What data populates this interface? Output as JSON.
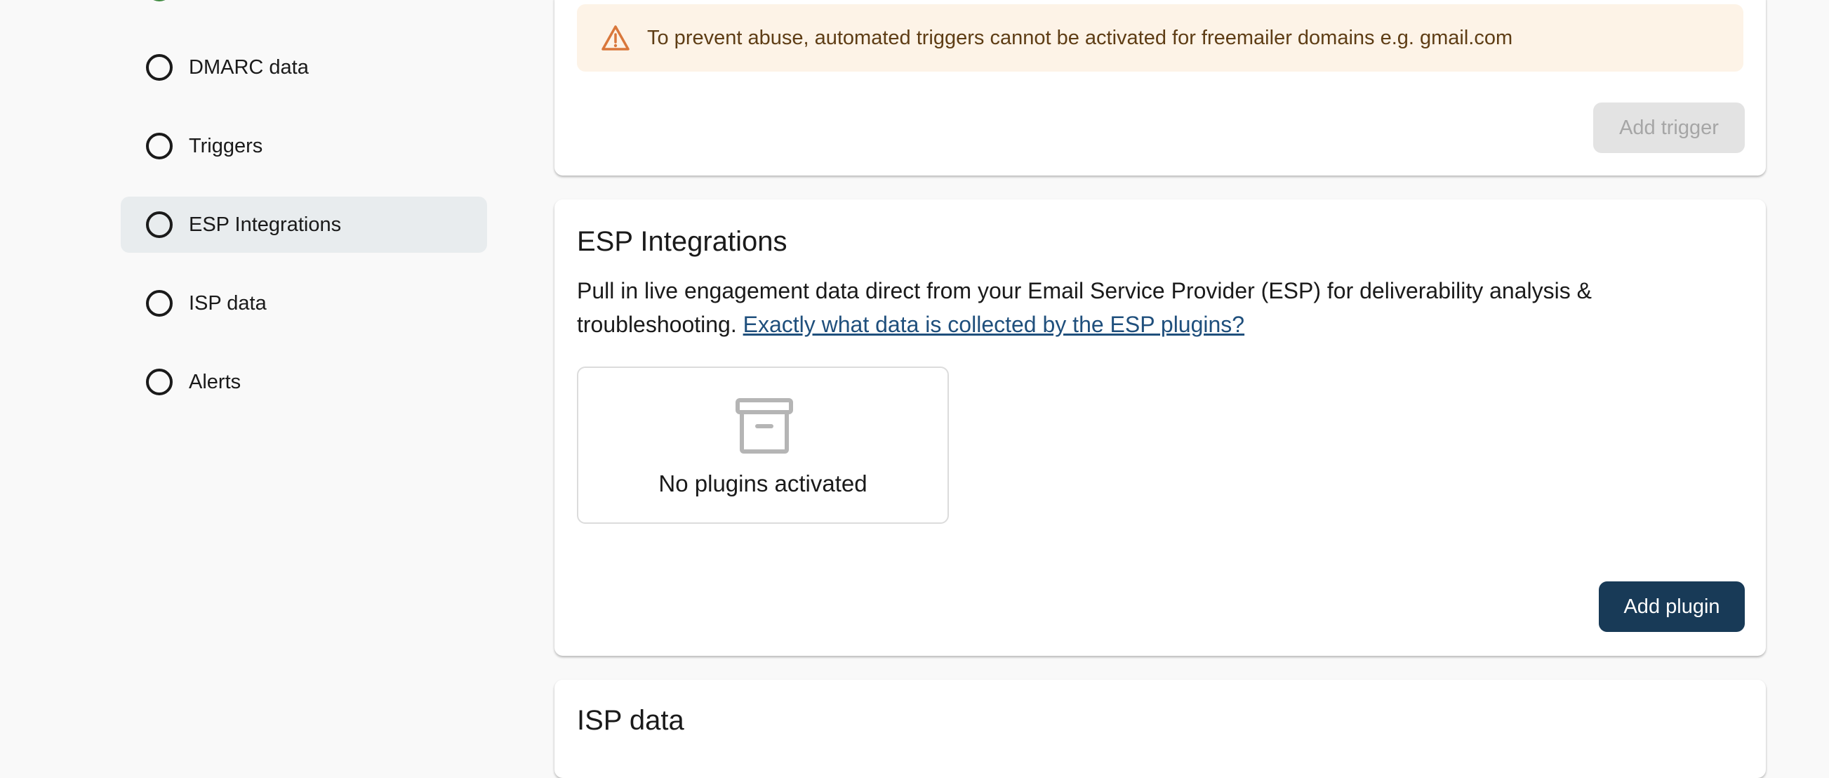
{
  "sidebar": {
    "items": [
      {
        "label": "DMARC data"
      },
      {
        "label": "Triggers"
      },
      {
        "label": "ESP Integrations"
      },
      {
        "label": "ISP data"
      },
      {
        "label": "Alerts"
      }
    ],
    "active_item": "ESP Integrations"
  },
  "triggers_card": {
    "notice_text": "To prevent abuse, automated triggers cannot be activated for freemailer domains e.g. gmail.com",
    "add_trigger_label": "Add trigger"
  },
  "esp_card": {
    "title": "ESP Integrations",
    "description": "Pull in live engagement data direct from your Email Service Provider (ESP) for deliverability analysis & troubleshooting.",
    "link_text": "Exactly what data is collected by the ESP plugins?",
    "empty_state_text": "No plugins activated",
    "add_plugin_label": "Add plugin"
  },
  "isp_card": {
    "title": "ISP data"
  },
  "colors": {
    "primary_button": "#183a57",
    "warning_bg": "#fdf3e7",
    "warning_icon": "#d9773b",
    "link": "#1f4f7c",
    "active_nav_bg": "#e8ecee",
    "completed_step": "#3f8a3f"
  },
  "icons": {
    "notice": "warning-triangle-icon",
    "empty_state": "archive-box-icon",
    "nav_step": "circle-outline-icon"
  }
}
